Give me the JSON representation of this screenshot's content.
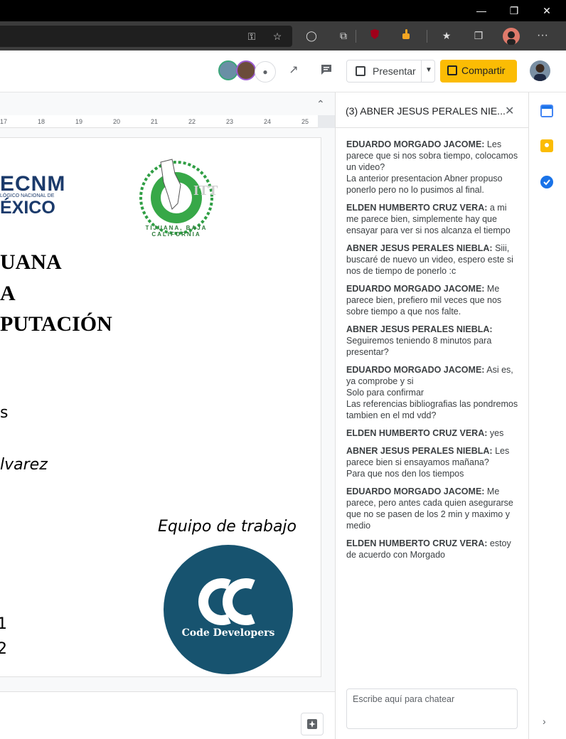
{
  "browser": {
    "window_controls": [
      "minimize-icon",
      "restore-icon",
      "close-icon"
    ],
    "toolbar_icons": [
      "key-icon",
      "star-icon",
      "circle-icon",
      "extension-icon",
      "ublock-icon",
      "thumbs-up-icon",
      "favorites-icon",
      "collections-icon",
      "profile-icon",
      "more-icon"
    ],
    "more_glyph": "···"
  },
  "docs_toolbar": {
    "presentar_label": "Presentar",
    "compartir_label": "Compartir",
    "accent": "#fbbc04"
  },
  "ruler": {
    "ticks": [
      "17",
      "18",
      "19",
      "20",
      "21",
      "22",
      "23",
      "24",
      "25"
    ]
  },
  "page": {
    "logo_left_line1": "ECNM",
    "logo_left_line2": "LÓGICO NACIONAL DE",
    "logo_left_line3": "ÉXICO",
    "seal_text": "TIJUANA, BAJA CALIFORNIA",
    "seal_letters": "ITT",
    "title_line1": "UANA",
    "title_line2": "A",
    "title_line3": "PUTACIÓN",
    "text_s": "s",
    "text_alvarez": "lvarez",
    "equipo_label": "Equipo de trabajo",
    "team_logo_text": "Code Developers",
    "text_1": "1",
    "text_2": "2",
    "team_logo_color": "#17536f"
  },
  "chat": {
    "title": "(3) ABNER JESUS PERALES NIE...",
    "messages": [
      {
        "author": "EDUARDO MORGADO JACOME:",
        "text": " Les parece que si nos sobra tiempo, colocamos un video?",
        "extra": [
          "La anterior presentacion Abner propuso ponerlo pero no lo pusimos al final."
        ]
      },
      {
        "author": "ELDEN HUMBERTO CRUZ VERA:",
        "text": " a mi me parece bien, simplemente hay que ensayar para ver si nos alcanza el tiempo",
        "extra": []
      },
      {
        "author": "ABNER JESUS PERALES NIEBLA:",
        "text": " Siii, buscaré de nuevo un video, espero este si nos de tiempo de ponerlo :c",
        "extra": []
      },
      {
        "author": "EDUARDO MORGADO JACOME:",
        "text": " Me parece bien, prefiero mil veces que nos sobre tiempo a que nos falte.",
        "extra": []
      },
      {
        "author": "ABNER JESUS PERALES NIEBLA:",
        "text": " Seguiremos teniendo 8 minutos para presentar?",
        "extra": []
      },
      {
        "author": "EDUARDO MORGADO JACOME:",
        "text": " Asi es, ya comprobe y si",
        "extra": [
          "Solo para confirmar",
          "Las referencias bibliografias las pondremos tambien en el md vdd?"
        ]
      },
      {
        "author": "ELDEN HUMBERTO CRUZ VERA:",
        "text": " yes",
        "extra": []
      },
      {
        "author": "ABNER JESUS PERALES NIEBLA:",
        "text": " Les parece bien si ensayamos mañana?",
        "extra": [
          "Para que nos den los tiempos"
        ]
      },
      {
        "author": "EDUARDO MORGADO JACOME:",
        "text": " Me parece, pero antes cada quien asegurarse que no se pasen de los 2 min y maximo y medio",
        "extra": []
      },
      {
        "author": "ELDEN HUMBERTO CRUZ VERA:",
        "text": " estoy de acuerdo con Morgado",
        "extra": []
      }
    ],
    "input_placeholder": "Escribe aquí para chatear"
  }
}
